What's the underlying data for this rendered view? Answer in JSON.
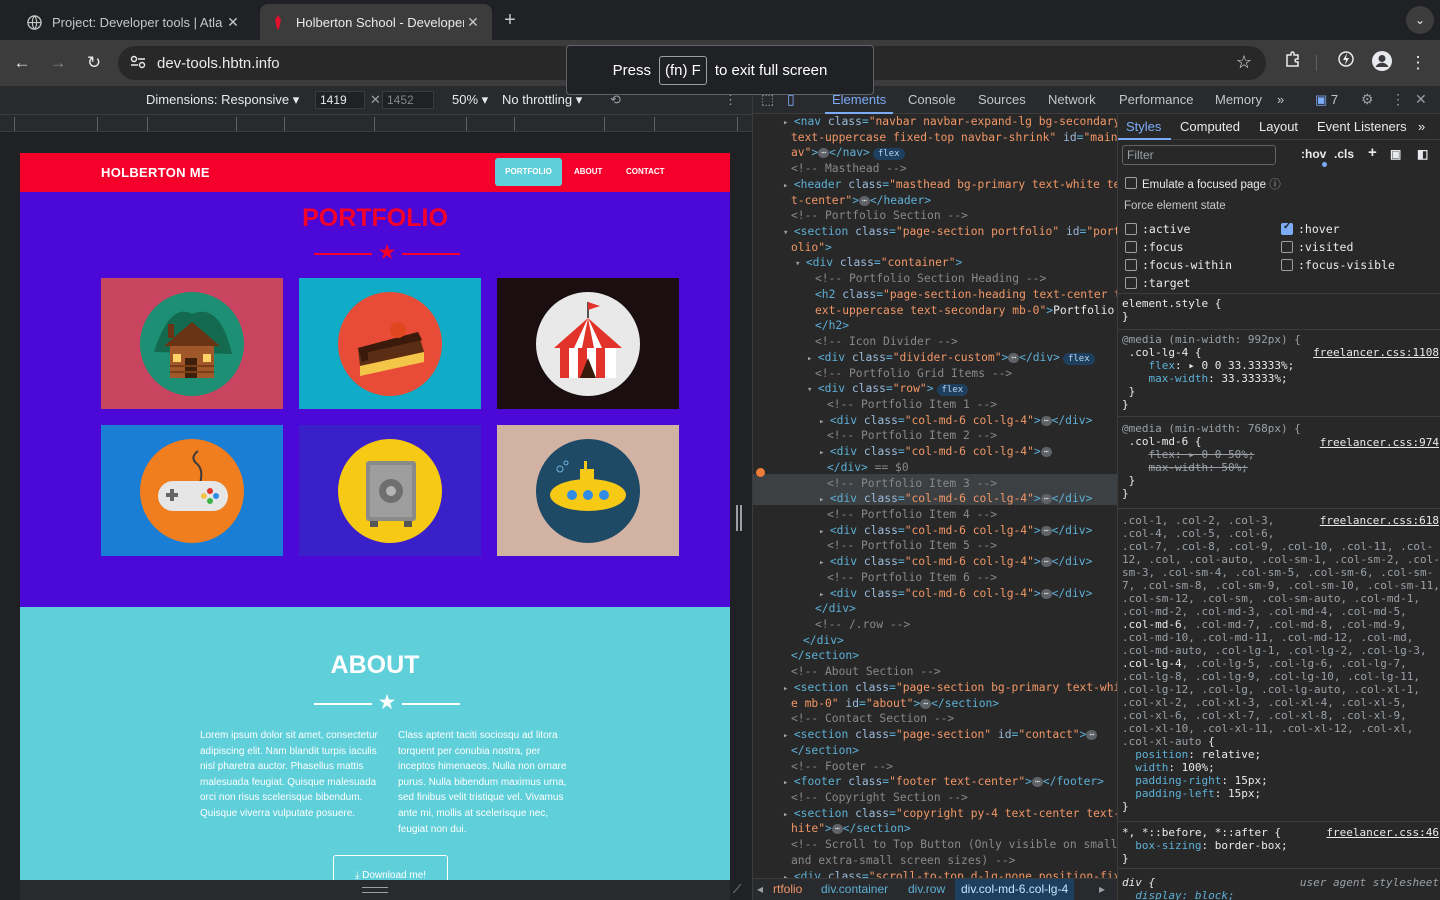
{
  "browser": {
    "tabs": [
      {
        "title": "Project: Developer tools | Atla",
        "active": false
      },
      {
        "title": "Holberton School - Developer",
        "active": true
      }
    ],
    "url": "dev-tools.hbtn.info",
    "fullscreen_toast": {
      "press": "Press",
      "key": "(fn) F",
      "rest": "to exit full screen"
    }
  },
  "device_toolbar": {
    "dimensions_label": "Dimensions: Responsive",
    "width": "1419",
    "height": "1452",
    "zoom": "50%",
    "throttling": "No throttling"
  },
  "site": {
    "brand": "HOLBERTON ME",
    "nav": [
      "PORTFOLIO",
      "ABOUT",
      "CONTACT"
    ],
    "portfolio_title": "PORTFOLIO",
    "about_title": "ABOUT",
    "about_p1": "Lorem ipsum dolor sit amet, consectetur adipiscing elit. Nam blandit turpis iaculis nisl pharetra auctor. Phasellus mattis malesuada feugiat. Quisque malesuada orci non risus scelerisque bibendum. Quisque viverra vulputate posuere.",
    "about_p2": "Class aptent taciti sociosqu ad litora torquent per conubia nostra, per inceptos himenaeos. Nulla non ornare purus. Nulla bibendum maximus urna, sed finibus velit tristique vel. Vivamus ante mi, mollis at scelerisque nec, feugiat non dui.",
    "download": "Download me!",
    "colors": {
      "nav": "#f5002b",
      "portfolio_bg": "#4b08d6",
      "about_bg": "#5fcfd9",
      "active_link": "#5fcfd9"
    },
    "cards": [
      {
        "icon": "cabin-icon",
        "bg": "#c9445e"
      },
      {
        "icon": "cake-icon",
        "bg": "#10abc6"
      },
      {
        "icon": "circus-tent-icon",
        "bg": "#1a0e10"
      },
      {
        "icon": "game-controller-icon",
        "bg": "#1a7fd4"
      },
      {
        "icon": "safe-icon",
        "bg": "#3a20c8"
      },
      {
        "icon": "submarine-icon",
        "bg": "#d2b3a3"
      }
    ]
  },
  "devtools": {
    "tabs": [
      "Elements",
      "Console",
      "Sources",
      "Network",
      "Performance",
      "Memory"
    ],
    "issues_count": "7",
    "dom_lines": [
      {
        "d": 0,
        "parts": [
          [
            "tri",
            "▸ "
          ],
          [
            "tg",
            "<nav "
          ],
          [
            "at",
            "class"
          ],
          [
            "tg",
            "="
          ],
          [
            "av",
            "\"navbar navbar-expand-lg bg-secondary"
          ]
        ]
      },
      {
        "d": 0,
        "parts": [
          [
            "av",
            "text-uppercase fixed-top navbar-shrink\" "
          ],
          [
            "at",
            "id"
          ],
          [
            "tg",
            "="
          ],
          [
            "av",
            "\"mainN"
          ]
        ]
      },
      {
        "d": 0,
        "parts": [
          [
            "av",
            "av\""
          ],
          [
            "tg",
            ">"
          ],
          [
            "ell",
            "⋯"
          ],
          [
            "tg",
            "</nav>"
          ],
          [
            "pill",
            "flex"
          ]
        ]
      },
      {
        "d": 0,
        "parts": [
          [
            "cm",
            "<!-- Masthead -->"
          ]
        ]
      },
      {
        "d": 0,
        "parts": [
          [
            "tri",
            "▸ "
          ],
          [
            "tg",
            "<header "
          ],
          [
            "at",
            "class"
          ],
          [
            "tg",
            "="
          ],
          [
            "av",
            "\"masthead bg-primary text-white tex"
          ]
        ]
      },
      {
        "d": 0,
        "parts": [
          [
            "av",
            "t-center\""
          ],
          [
            "tg",
            ">"
          ],
          [
            "ell",
            "⋯"
          ],
          [
            "tg",
            "</header>"
          ]
        ]
      },
      {
        "d": 0,
        "parts": [
          [
            "cm",
            "<!-- Portfolio Section -->"
          ]
        ]
      },
      {
        "d": 0,
        "parts": [
          [
            "tri",
            "▾ "
          ],
          [
            "tg",
            "<section "
          ],
          [
            "at",
            "class"
          ],
          [
            "tg",
            "="
          ],
          [
            "av",
            "\"page-section portfolio\" "
          ],
          [
            "at",
            "id"
          ],
          [
            "tg",
            "="
          ],
          [
            "av",
            "\"portf"
          ]
        ]
      },
      {
        "d": 0,
        "parts": [
          [
            "av",
            "olio\""
          ],
          [
            "tg",
            ">"
          ]
        ]
      },
      {
        "d": 1,
        "parts": [
          [
            "tri",
            "▾ "
          ],
          [
            "tg",
            "<div "
          ],
          [
            "at",
            "class"
          ],
          [
            "tg",
            "="
          ],
          [
            "av",
            "\"container\""
          ],
          [
            "tg",
            ">"
          ]
        ]
      },
      {
        "d": 2,
        "parts": [
          [
            "cm",
            "<!-- Portfolio Section Heading -->"
          ]
        ]
      },
      {
        "d": 2,
        "parts": [
          [
            "tg",
            "<h2 "
          ],
          [
            "at",
            "class"
          ],
          [
            "tg",
            "="
          ],
          [
            "av",
            "\"page-section-heading text-center t"
          ]
        ]
      },
      {
        "d": 2,
        "parts": [
          [
            "av",
            "ext-uppercase text-secondary mb-0\""
          ],
          [
            "tg",
            ">"
          ],
          [
            "tx",
            "Portfolio"
          ]
        ]
      },
      {
        "d": 2,
        "parts": [
          [
            "tg",
            "</h2>"
          ]
        ]
      },
      {
        "d": 2,
        "parts": [
          [
            "cm",
            "<!-- Icon Divider -->"
          ]
        ]
      },
      {
        "d": 2,
        "parts": [
          [
            "tri",
            "▸ "
          ],
          [
            "tg",
            "<div "
          ],
          [
            "at",
            "class"
          ],
          [
            "tg",
            "="
          ],
          [
            "av",
            "\"divider-custom\""
          ],
          [
            "tg",
            ">"
          ],
          [
            "ell",
            "⋯"
          ],
          [
            "tg",
            "</div>"
          ],
          [
            "pill",
            "flex"
          ]
        ]
      },
      {
        "d": 2,
        "parts": [
          [
            "cm",
            "<!-- Portfolio Grid Items -->"
          ]
        ]
      },
      {
        "d": 2,
        "parts": [
          [
            "tri",
            "▾ "
          ],
          [
            "tg",
            "<div "
          ],
          [
            "at",
            "class"
          ],
          [
            "tg",
            "="
          ],
          [
            "av",
            "\"row\""
          ],
          [
            "tg",
            ">"
          ],
          [
            "pill",
            "flex"
          ]
        ]
      },
      {
        "d": 3,
        "parts": [
          [
            "cm",
            "<!-- Portfolio Item 1 -->"
          ]
        ]
      },
      {
        "d": 3,
        "parts": [
          [
            "tri",
            "▸ "
          ],
          [
            "tg",
            "<div "
          ],
          [
            "at",
            "class"
          ],
          [
            "tg",
            "="
          ],
          [
            "av",
            "\"col-md-6 col-lg-4\""
          ],
          [
            "tg",
            ">"
          ],
          [
            "ell",
            "⋯"
          ],
          [
            "tg",
            "</div>"
          ]
        ]
      },
      {
        "d": 3,
        "parts": [
          [
            "cm",
            "<!-- Portfolio Item 2 -->"
          ]
        ]
      },
      {
        "d": 3,
        "parts": [
          [
            "tri",
            "▸ "
          ],
          [
            "tg",
            "<div "
          ],
          [
            "at",
            "class"
          ],
          [
            "tg",
            "="
          ],
          [
            "av",
            "\"col-md-6 col-lg-4\""
          ],
          [
            "tg",
            ">"
          ],
          [
            "ell",
            "⋯"
          ]
        ]
      },
      {
        "d": 3,
        "parts": [
          [
            "tg",
            "</div>"
          ],
          [
            "cm",
            " == $0"
          ]
        ]
      },
      {
        "d": 3,
        "parts": [
          [
            "cm",
            "<!-- Portfolio Item 3 -->"
          ]
        ]
      },
      {
        "d": 3,
        "parts": [
          [
            "tri",
            "▸ "
          ],
          [
            "tg",
            "<div "
          ],
          [
            "at",
            "class"
          ],
          [
            "tg",
            "="
          ],
          [
            "av",
            "\"col-md-6 col-lg-4\""
          ],
          [
            "tg",
            ">"
          ],
          [
            "ell",
            "⋯"
          ],
          [
            "tg",
            "</div>"
          ]
        ]
      },
      {
        "d": 3,
        "parts": [
          [
            "cm",
            "<!-- Portfolio Item 4 -->"
          ]
        ]
      },
      {
        "d": 3,
        "parts": [
          [
            "tri",
            "▸ "
          ],
          [
            "tg",
            "<div "
          ],
          [
            "at",
            "class"
          ],
          [
            "tg",
            "="
          ],
          [
            "av",
            "\"col-md-6 col-lg-4\""
          ],
          [
            "tg",
            ">"
          ],
          [
            "ell",
            "⋯"
          ],
          [
            "tg",
            "</div>"
          ]
        ]
      },
      {
        "d": 3,
        "parts": [
          [
            "cm",
            "<!-- Portfolio Item 5 -->"
          ]
        ]
      },
      {
        "d": 3,
        "parts": [
          [
            "tri",
            "▸ "
          ],
          [
            "tg",
            "<div "
          ],
          [
            "at",
            "class"
          ],
          [
            "tg",
            "="
          ],
          [
            "av",
            "\"col-md-6 col-lg-4\""
          ],
          [
            "tg",
            ">"
          ],
          [
            "ell",
            "⋯"
          ],
          [
            "tg",
            "</div>"
          ]
        ]
      },
      {
        "d": 3,
        "parts": [
          [
            "cm",
            "<!-- Portfolio Item 6 -->"
          ]
        ]
      },
      {
        "d": 3,
        "parts": [
          [
            "tri",
            "▸ "
          ],
          [
            "tg",
            "<div "
          ],
          [
            "at",
            "class"
          ],
          [
            "tg",
            "="
          ],
          [
            "av",
            "\"col-md-6 col-lg-4\""
          ],
          [
            "tg",
            ">"
          ],
          [
            "ell",
            "⋯"
          ],
          [
            "tg",
            "</div>"
          ]
        ]
      },
      {
        "d": 2,
        "parts": [
          [
            "tg",
            "</div>"
          ]
        ]
      },
      {
        "d": 2,
        "parts": [
          [
            "cm",
            "<!-- /.row -->"
          ]
        ]
      },
      {
        "d": 1,
        "parts": [
          [
            "tg",
            "</div>"
          ]
        ]
      },
      {
        "d": 0,
        "parts": [
          [
            "tg",
            "</section>"
          ]
        ]
      },
      {
        "d": 0,
        "parts": [
          [
            "cm",
            "<!-- About Section -->"
          ]
        ]
      },
      {
        "d": 0,
        "parts": [
          [
            "tri",
            "▸ "
          ],
          [
            "tg",
            "<section "
          ],
          [
            "at",
            "class"
          ],
          [
            "tg",
            "="
          ],
          [
            "av",
            "\"page-section bg-primary text-whit"
          ]
        ]
      },
      {
        "d": 0,
        "parts": [
          [
            "av",
            "e mb-0\" "
          ],
          [
            "at",
            "id"
          ],
          [
            "tg",
            "="
          ],
          [
            "av",
            "\"about\""
          ],
          [
            "tg",
            ">"
          ],
          [
            "ell",
            "⋯"
          ],
          [
            "tg",
            "</section>"
          ]
        ]
      },
      {
        "d": 0,
        "parts": [
          [
            "cm",
            "<!-- Contact Section -->"
          ]
        ]
      },
      {
        "d": 0,
        "parts": [
          [
            "tri",
            "▸ "
          ],
          [
            "tg",
            "<section "
          ],
          [
            "at",
            "class"
          ],
          [
            "tg",
            "="
          ],
          [
            "av",
            "\"page-section\" "
          ],
          [
            "at",
            "id"
          ],
          [
            "tg",
            "="
          ],
          [
            "av",
            "\"contact\""
          ],
          [
            "tg",
            ">"
          ],
          [
            "ell",
            "⋯"
          ]
        ]
      },
      {
        "d": 0,
        "parts": [
          [
            "tg",
            "</section>"
          ]
        ]
      },
      {
        "d": 0,
        "parts": [
          [
            "cm",
            "<!-- Footer -->"
          ]
        ]
      },
      {
        "d": 0,
        "parts": [
          [
            "tri",
            "▸ "
          ],
          [
            "tg",
            "<footer "
          ],
          [
            "at",
            "class"
          ],
          [
            "tg",
            "="
          ],
          [
            "av",
            "\"footer text-center\""
          ],
          [
            "tg",
            ">"
          ],
          [
            "ell",
            "⋯"
          ],
          [
            "tg",
            "</footer>"
          ]
        ]
      },
      {
        "d": 0,
        "parts": [
          [
            "cm",
            "<!-- Copyright Section -->"
          ]
        ]
      },
      {
        "d": 0,
        "parts": [
          [
            "tri",
            "▸ "
          ],
          [
            "tg",
            "<section "
          ],
          [
            "at",
            "class"
          ],
          [
            "tg",
            "="
          ],
          [
            "av",
            "\"copyright py-4 text-center text-w"
          ]
        ]
      },
      {
        "d": 0,
        "parts": [
          [
            "av",
            "hite\""
          ],
          [
            "tg",
            ">"
          ],
          [
            "ell",
            "⋯"
          ],
          [
            "tg",
            "</section>"
          ]
        ]
      },
      {
        "d": 0,
        "parts": [
          [
            "cm",
            "<!-- Scroll to Top Button (Only visible on small"
          ]
        ]
      },
      {
        "d": 0,
        "parts": [
          [
            "cm",
            "and extra-small screen sizes) -->"
          ]
        ]
      },
      {
        "d": 0,
        "parts": [
          [
            "tri",
            "▸ "
          ],
          [
            "tg",
            "<div "
          ],
          [
            "at",
            "class"
          ],
          [
            "tg",
            "="
          ],
          [
            "av",
            "\"scroll-to-top d-lg-none position-fixe"
          ]
        ]
      }
    ],
    "breadcrumbs": [
      "rtfolio",
      "div.container",
      "div.row",
      "div.col-md-6.col-lg-4"
    ],
    "styles": {
      "tabs": [
        "Styles",
        "Computed",
        "Layout",
        "Event Listeners"
      ],
      "filter_placeholder": "Filter",
      "hov": ":hov",
      "cls": ".cls",
      "emulate_focus": "Emulate a focused page",
      "force_state": "Force element state",
      "states": [
        {
          "name": ":active",
          "checked": false
        },
        {
          "name": ":hover",
          "checked": true
        },
        {
          "name": ":focus",
          "checked": false
        },
        {
          "name": ":visited",
          "checked": false
        },
        {
          "name": ":focus-within",
          "checked": false
        },
        {
          "name": ":focus-visible",
          "checked": false
        },
        {
          "name": ":target",
          "checked": false
        }
      ],
      "element_style": "element.style {",
      "rule1_media": "@media (min-width: 992px) {",
      "rule1_sel": ".col-lg-4 {",
      "rule1_src": "freelancer.css:1108",
      "rule1_p1": "flex",
      "rule1_v1": "▸ 0 0 33.33333%;",
      "rule1_p2": "max-width",
      "rule1_v2": "33.33333%;",
      "rule2_media": "@media (min-width: 768px) {",
      "rule2_sel": ".col-md-6 {",
      "rule2_src": "freelancer.css:974",
      "rule2_p1": "flex: ▸ 0 0 50%;",
      "rule2_p2": "max-width: 50%;",
      "rule3_src": "freelancer.css:618",
      "rule3_p1": "position",
      "rule3_v1": "relative;",
      "rule3_p2": "width",
      "rule3_v2": "100%;",
      "rule3_p3": "padding-right",
      "rule3_v3": "15px;",
      "rule3_p4": "padding-left",
      "rule3_v4": "15px;",
      "rule4_sel": "*, *::before, *::after {",
      "rule4_src": "freelancer.css:46",
      "rule4_p1": "box-sizing",
      "rule4_v1": "border-box;",
      "rule5_sel": "div {",
      "rule5_src": "user agent stylesheet",
      "rule5_p1": "display: block;"
    }
  }
}
